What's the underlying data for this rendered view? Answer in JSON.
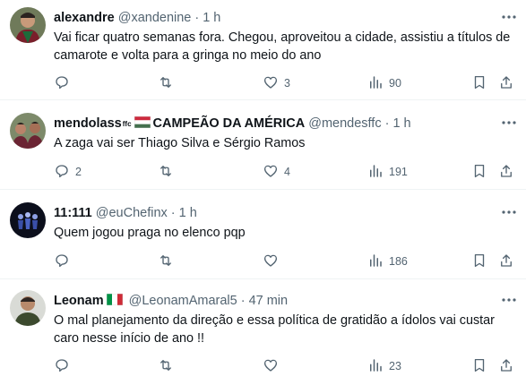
{
  "tweets": [
    {
      "name": "alexandre",
      "handle": "@xandenine",
      "time": "1 h",
      "text": "Vai ficar quatro semanas fora. Chegou, aproveitou a cidade, assistiu a títulos de camarote e volta para a gringa no meio do ano",
      "replies": "",
      "reposts": "",
      "likes": "3",
      "views": "90"
    },
    {
      "name": "mendolass",
      "name_sup": "ffc",
      "name_flag": "hungary-flag",
      "name_suffix": "CAMPEÃO DA AMÉRICA",
      "handle": "@mendesffc",
      "time": "1 h",
      "text": "A zaga vai ser Thiago Silva e Sérgio Ramos",
      "replies": "2",
      "reposts": "",
      "likes": "4",
      "views": "191"
    },
    {
      "name": "11:111",
      "handle": "@euChefinx",
      "time": "1 h",
      "text": "Quem jogou praga no elenco pqp",
      "replies": "",
      "reposts": "",
      "likes": "",
      "views": "186"
    },
    {
      "name": "Leonam",
      "name_flag": "italy-flag",
      "handle": "@LeonamAmaral5",
      "time": "47 min",
      "text": "O mal planejamento da direção e essa política de gratidão a ídolos vai custar caro nesse início de ano !!",
      "replies": "",
      "reposts": "",
      "likes": "",
      "views": "23"
    }
  ],
  "separator": "·",
  "colors": {
    "text": "#0f1419",
    "muted": "#536471",
    "border": "#eff3f4"
  }
}
